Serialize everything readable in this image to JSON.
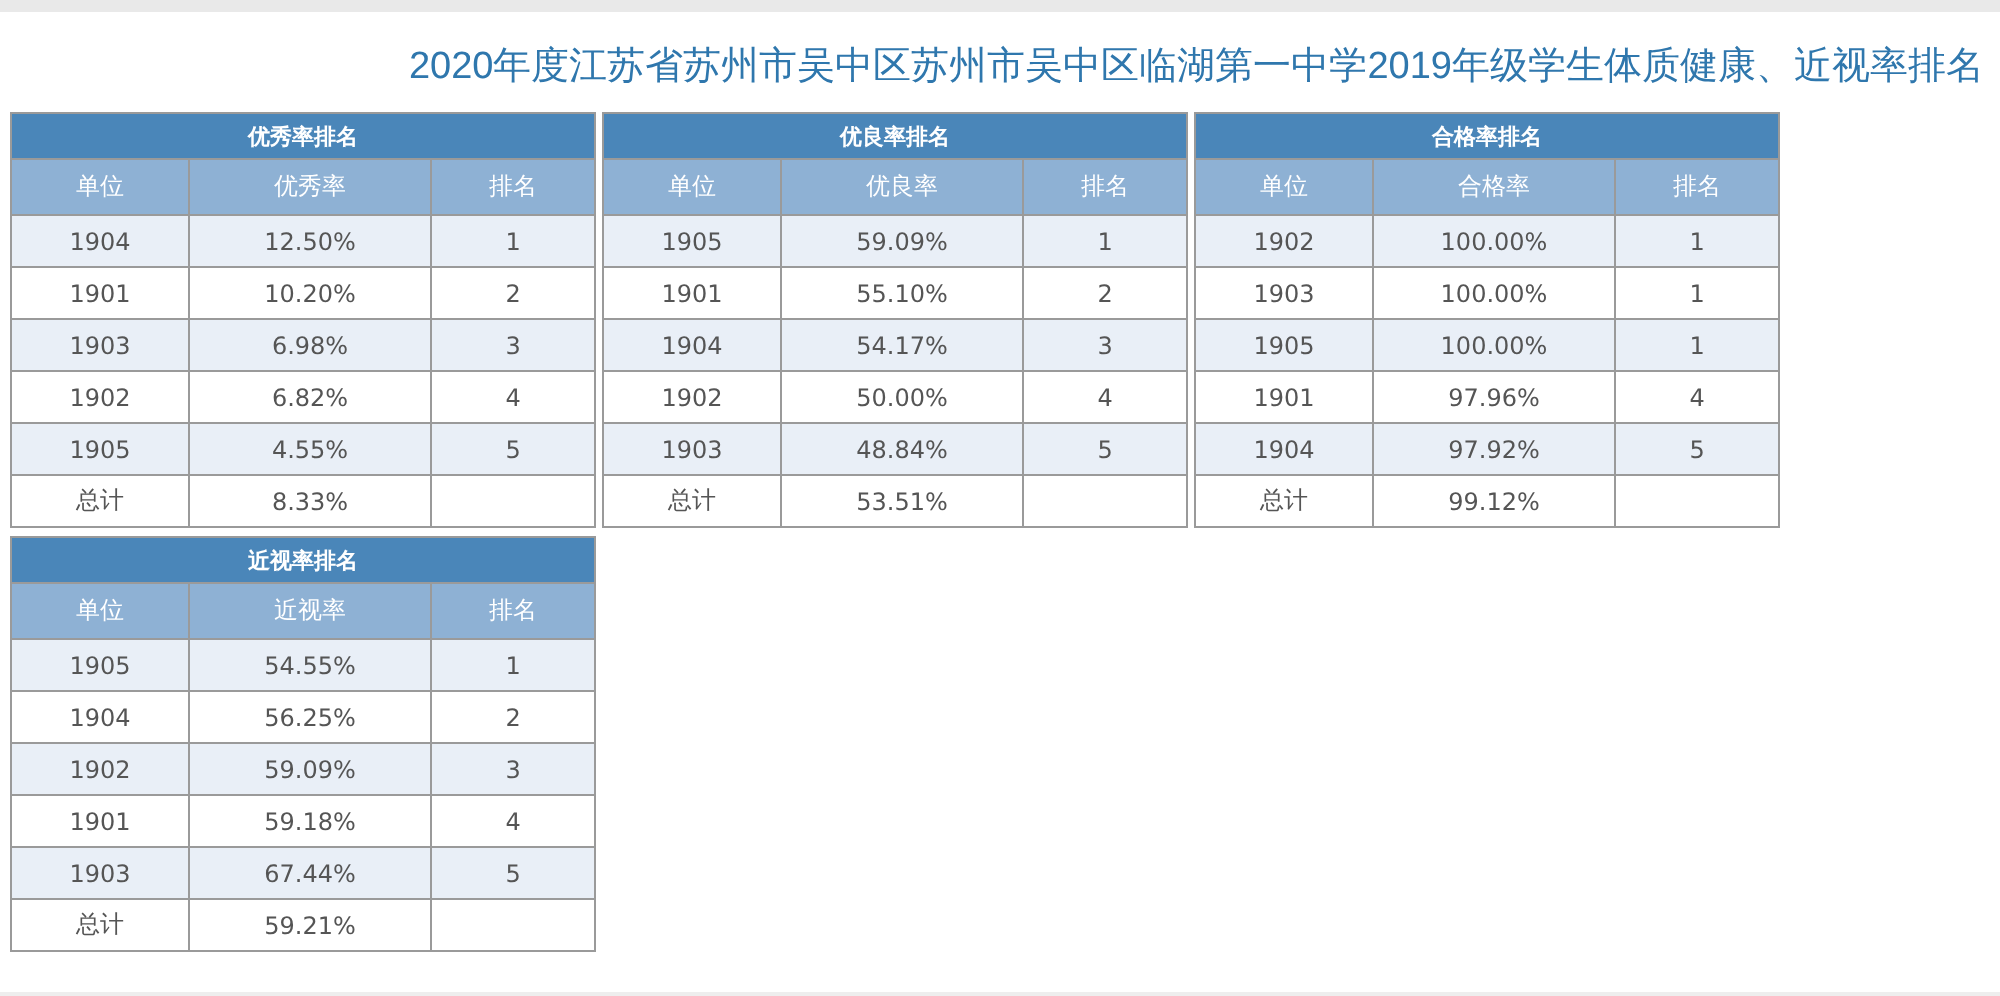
{
  "title": "2020年度江苏省苏州市吴中区苏州市吴中区临湖第一中学2019年级学生体质健康、近视率排名",
  "tables": [
    {
      "caption": "优秀率排名",
      "columns": [
        "单位",
        "优秀率",
        "排名"
      ],
      "rows": [
        [
          "1904",
          "12.50%",
          "1"
        ],
        [
          "1901",
          "10.20%",
          "2"
        ],
        [
          "1903",
          "6.98%",
          "3"
        ],
        [
          "1902",
          "6.82%",
          "4"
        ],
        [
          "1905",
          "4.55%",
          "5"
        ],
        [
          "总计",
          "8.33%",
          ""
        ]
      ]
    },
    {
      "caption": "优良率排名",
      "columns": [
        "单位",
        "优良率",
        "排名"
      ],
      "rows": [
        [
          "1905",
          "59.09%",
          "1"
        ],
        [
          "1901",
          "55.10%",
          "2"
        ],
        [
          "1904",
          "54.17%",
          "3"
        ],
        [
          "1902",
          "50.00%",
          "4"
        ],
        [
          "1903",
          "48.84%",
          "5"
        ],
        [
          "总计",
          "53.51%",
          ""
        ]
      ]
    },
    {
      "caption": "合格率排名",
      "columns": [
        "单位",
        "合格率",
        "排名"
      ],
      "rows": [
        [
          "1902",
          "100.00%",
          "1"
        ],
        [
          "1903",
          "100.00%",
          "1"
        ],
        [
          "1905",
          "100.00%",
          "1"
        ],
        [
          "1901",
          "97.96%",
          "4"
        ],
        [
          "1904",
          "97.92%",
          "5"
        ],
        [
          "总计",
          "99.12%",
          ""
        ]
      ]
    },
    {
      "caption": "近视率排名",
      "columns": [
        "单位",
        "近视率",
        "排名"
      ],
      "rows": [
        [
          "1905",
          "54.55%",
          "1"
        ],
        [
          "1904",
          "56.25%",
          "2"
        ],
        [
          "1902",
          "59.09%",
          "3"
        ],
        [
          "1901",
          "59.18%",
          "4"
        ],
        [
          "1903",
          "67.44%",
          "5"
        ],
        [
          "总计",
          "59.21%",
          ""
        ]
      ]
    }
  ]
}
